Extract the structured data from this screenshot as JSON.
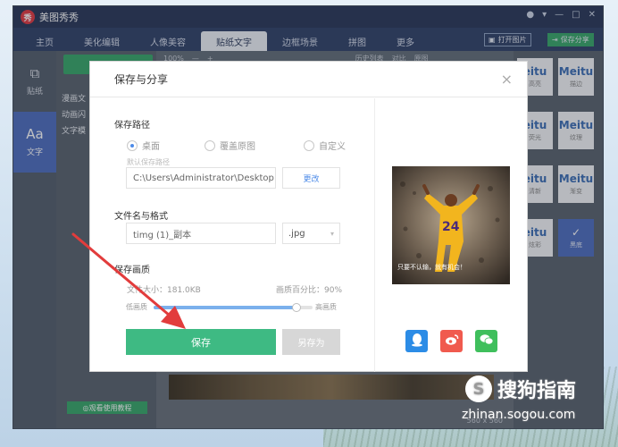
{
  "app": {
    "title": "美图秀秀",
    "logo_text": "秀",
    "window_controls": [
      "●",
      "▾",
      "—",
      "□",
      "✕"
    ]
  },
  "main_tabs": [
    {
      "label": "主页"
    },
    {
      "label": "美化编辑"
    },
    {
      "label": "人像美容"
    },
    {
      "label": "贴纸文字"
    },
    {
      "label": "边框场景"
    },
    {
      "label": "拼图"
    },
    {
      "label": "更多"
    }
  ],
  "top_actions": {
    "open_image": "打开图片",
    "save_share": "保存分享"
  },
  "left_nav": [
    {
      "icon": "sticker-icon",
      "glyph": "⧉",
      "label": "贴纸"
    },
    {
      "icon": "text-icon",
      "glyph": "Aa",
      "label": "文字"
    }
  ],
  "category_items": [
    "漫画文",
    "动画闪",
    "文字模"
  ],
  "help_button": "◎观看使用教程",
  "canvas_toolbar": {
    "zoom": "100%",
    "history": "历史列表",
    "compare": "对比",
    "original": "原图"
  },
  "image_size": "560 x 560",
  "right_tiles": [
    {
      "title": "eitu",
      "sub": "高亮"
    },
    {
      "title": "Meitu",
      "sub": "描边"
    },
    {
      "title": "eitu",
      "sub": "荧光"
    },
    {
      "title": "Meitu",
      "sub": "纹理"
    },
    {
      "title": "eitu",
      "sub": "清新"
    },
    {
      "title": "Meitu",
      "sub": "渐变"
    },
    {
      "title": "eitu",
      "sub": "炫彩"
    },
    {
      "title": "✓",
      "sub": "黑底"
    }
  ],
  "dialog": {
    "title": "保存与分享",
    "close": "×",
    "path_section": "保存路径",
    "path_options": [
      {
        "label": "桌面",
        "selected": true
      },
      {
        "label": "覆盖原图",
        "selected": false
      },
      {
        "label": "自定义",
        "selected": false
      }
    ],
    "default_path_hint": "默认保存路径",
    "path_value": "C:\\Users\\Administrator\\Desktop",
    "change_button": "更改",
    "name_section": "文件名与格式",
    "filename": "timg (1)_副本",
    "format": ".jpg",
    "quality_section": "保存画质",
    "file_size": "文件大小：181.0KB",
    "quality_percent_label": "画质百分比：90%",
    "quality_value": 0.9,
    "low_label": "低画质",
    "high_label": "高画质",
    "save_button": "保存",
    "save_as_button": "另存为",
    "preview_caption": "只要不认输，就有机会！",
    "preview_jersey": "24"
  },
  "share_buttons": [
    {
      "icon": "qq-icon",
      "color": "#2c8ce6"
    },
    {
      "icon": "weibo-icon",
      "color": "#f05a4e"
    },
    {
      "icon": "wechat-icon",
      "color": "#3fbf5c"
    }
  ],
  "watermark": {
    "brand": "搜狗指南",
    "logo": "S",
    "url": "zhinan.sogou.com"
  },
  "colors": {
    "accent_green": "#3eba83",
    "arrow_red": "#e23c3c",
    "tab_active": "#eef2f7"
  }
}
